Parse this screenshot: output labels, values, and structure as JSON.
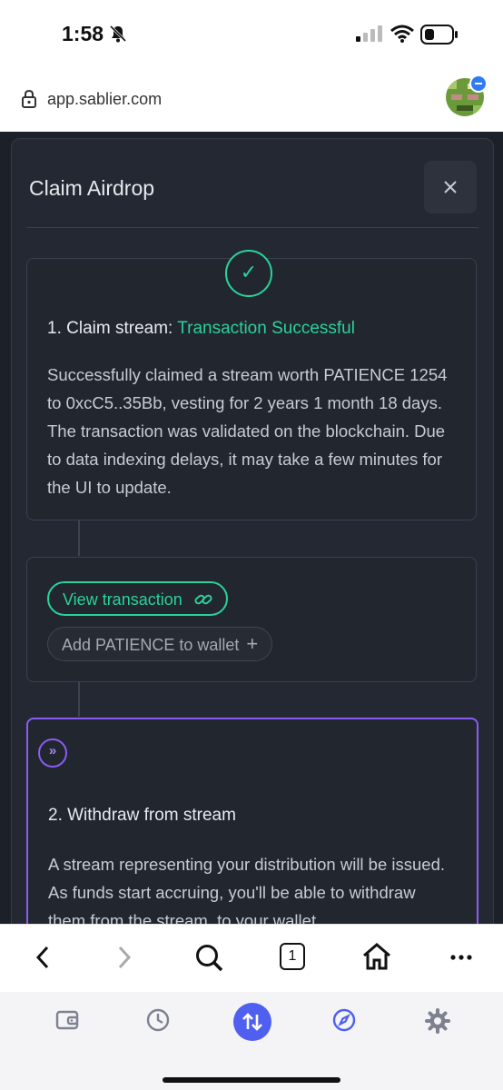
{
  "status_bar": {
    "time": "1:58"
  },
  "browser": {
    "url": "app.sablier.com",
    "tab_count": "1"
  },
  "modal": {
    "title": "Claim Airdrop",
    "step1": {
      "title_prefix": "1. Claim stream:",
      "title_status": "Transaction Successful",
      "body": "Successfully claimed a stream worth PATIENCE 1254 to 0xcC5..35Bb, vesting for 2 years 1 month 18 days. The transaction was validated on the blockchain. Due to data indexing delays, it may take a few minutes for the UI to update."
    },
    "actions": {
      "view_tx": "View transaction",
      "add_token": "Add PATIENCE to wallet"
    },
    "step2": {
      "title": "2. Withdraw from stream",
      "body": "A stream representing your distribution will be issued. As funds start accruing, you'll be able to withdraw them from the stream, to your wallet."
    }
  },
  "colors": {
    "accent_green": "#2ad29a",
    "accent_purple": "#8a5cf0",
    "tab_active": "#4f5ff0"
  },
  "icons": [
    "bell-slash-icon",
    "signal-icon",
    "wifi-icon",
    "battery-icon",
    "lock-icon",
    "close-icon",
    "check-icon",
    "link-icon",
    "plus-icon",
    "chevron-double-right-icon",
    "back-icon",
    "forward-icon",
    "search-icon",
    "home-icon",
    "more-icon",
    "wallet-icon",
    "clock-icon",
    "swap-icon",
    "compass-icon",
    "gear-icon"
  ]
}
